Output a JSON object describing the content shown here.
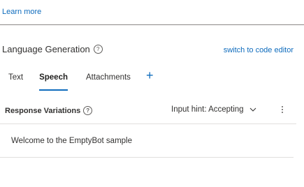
{
  "learn_more": "Learn more",
  "lg": {
    "title": "Language Generation",
    "help_icon": "?",
    "switch_link": "switch to code editor"
  },
  "tabs": [
    {
      "label": "Text",
      "active": false
    },
    {
      "label": "Speech",
      "active": true
    },
    {
      "label": "Attachments",
      "active": false
    }
  ],
  "add_tab_icon": "+",
  "responses": {
    "title": "Response Variations",
    "help_icon": "?",
    "input_hint": "Input hint: Accepting",
    "items": [
      "Welcome to the EmptyBot sample"
    ]
  },
  "colors": {
    "accent": "#0f6cbd",
    "text": "#323130",
    "divider": "#e1dfdd"
  }
}
